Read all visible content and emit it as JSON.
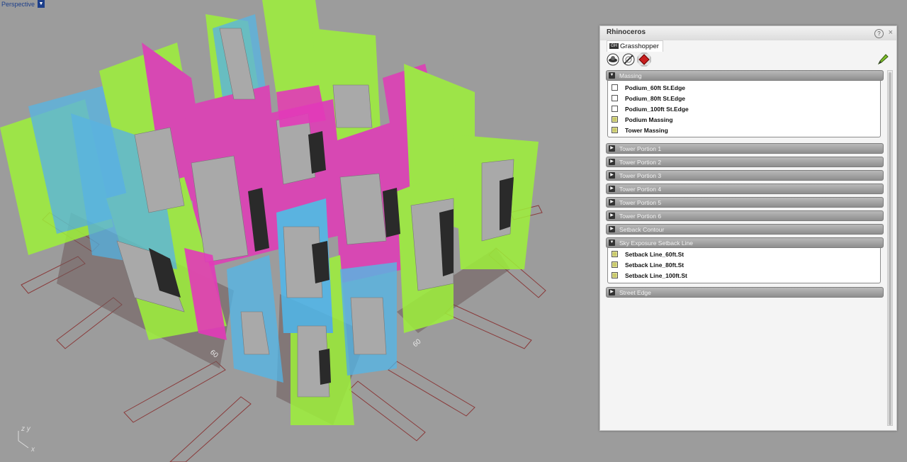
{
  "viewport": {
    "name": "Perspective",
    "axis_labels": {
      "z": "z",
      "y": "y",
      "x": "x"
    },
    "street_labels": [
      "60",
      "60"
    ]
  },
  "panel": {
    "title": "Rhinoceros",
    "tab_label": "Grasshopper",
    "tab_icon_text": "GH",
    "help_glyph": "?",
    "close_glyph": "×",
    "groups": [
      {
        "label": "Massing",
        "expanded": true,
        "items": [
          {
            "label": "Podium_60ft St.Edge",
            "checked": false
          },
          {
            "label": "Podium_80ft St.Edge",
            "checked": false
          },
          {
            "label": "Podium_100ft St.Edge",
            "checked": false
          },
          {
            "label": "Podium Massing",
            "checked": true
          },
          {
            "label": "Tower Massing",
            "checked": true
          }
        ]
      },
      {
        "label": "Tower Portion 1",
        "expanded": false
      },
      {
        "label": "Tower Portion 2",
        "expanded": false
      },
      {
        "label": "Tower Portion 3",
        "expanded": false
      },
      {
        "label": "Tower Portion 4",
        "expanded": false
      },
      {
        "label": "Tower Portion 5",
        "expanded": false
      },
      {
        "label": "Tower Portion 6",
        "expanded": false
      },
      {
        "label": "Setback Contour",
        "expanded": false
      },
      {
        "label": "Sky Exposure Setback Line",
        "expanded": true,
        "items": [
          {
            "label": "Setback Line_60ft.St",
            "checked": true
          },
          {
            "label": "Setback Line_80ft.St",
            "checked": true
          },
          {
            "label": "Setback Line_100ft.St",
            "checked": true
          }
        ]
      },
      {
        "label": "Street Edge",
        "expanded": false
      }
    ]
  },
  "colors": {
    "viewport_bg": "#9c9c9c",
    "magenta": "#e23ab8",
    "cyan": "#4fb8ec",
    "lime": "#9ef13a",
    "mass_grey": "#a9a9a9",
    "street_line": "#8a3a3a"
  }
}
